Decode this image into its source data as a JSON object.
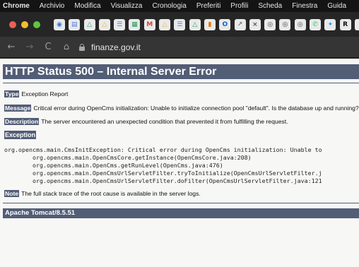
{
  "menubar": {
    "app": "Chrome",
    "items": [
      "Archivio",
      "Modifica",
      "Visualizza",
      "Cronologia",
      "Preferiti",
      "Profili",
      "Scheda",
      "Finestra",
      "Guida"
    ]
  },
  "tabs": {
    "icons": [
      {
        "name": "globe-icon",
        "glyph": "◉",
        "color": "#3a6fd8"
      },
      {
        "name": "docs-icon",
        "glyph": "▤",
        "color": "#4a7ee8"
      },
      {
        "name": "drive-icon",
        "glyph": "△",
        "color": "#2ea160"
      },
      {
        "name": "drive-icon",
        "glyph": "△",
        "color": "#f2b233"
      },
      {
        "name": "docs-icon",
        "glyph": "☰",
        "color": "#4a7ee8"
      },
      {
        "name": "sheets-icon",
        "glyph": "▦",
        "color": "#1f9b57"
      },
      {
        "name": "gmail-icon",
        "glyph": "M",
        "color": "#d44638"
      },
      {
        "name": "drive-icon",
        "glyph": "△",
        "color": "#f2b233"
      },
      {
        "name": "docs-icon",
        "glyph": "☰",
        "color": "#4a7ee8"
      },
      {
        "name": "drive-icon",
        "glyph": "△",
        "color": "#2ea160"
      },
      {
        "name": "analytics-icon",
        "glyph": "▮",
        "color": "#e37400"
      },
      {
        "name": "outlook-icon",
        "glyph": "O",
        "color": "#0a64c8"
      },
      {
        "name": "sparkline-icon",
        "glyph": "↗",
        "color": "#777777"
      },
      {
        "name": "tab-close-icon",
        "glyph": "×",
        "color": "#555555"
      },
      {
        "name": "circle-icon",
        "glyph": "◎",
        "color": "#444444"
      },
      {
        "name": "circle-icon",
        "glyph": "◎",
        "color": "#444444"
      },
      {
        "name": "circle-icon",
        "glyph": "◎",
        "color": "#444444"
      },
      {
        "name": "whatsapp-icon",
        "glyph": "✆",
        "color": "#25d366"
      },
      {
        "name": "twitter-icon",
        "glyph": "✦",
        "color": "#1da1f2"
      },
      {
        "name": "r-icon",
        "glyph": "R",
        "color": "#111111"
      },
      {
        "name": "doc-icon",
        "glyph": "▯",
        "color": "#6b6b6b"
      }
    ]
  },
  "address_bar": {
    "url": "finanze.gov.it"
  },
  "page": {
    "title": "HTTP Status 500 – Internal Server Error",
    "type_label": "Type",
    "type_value": "Exception Report",
    "message_label": "Message",
    "message_value": "Critical error during OpenCms initialization: Unable to initialize connection pool \"default\". Is the database up and running?",
    "description_label": "Description",
    "description_value": "The server encountered an unexpected condition that prevented it from fulfilling the request.",
    "exception_label": "Exception",
    "stack": [
      "org.opencms.main.CmsInitException: Critical error during OpenCms initialization: Unable to",
      "        org.opencms.main.OpenCmsCore.getInstance(OpenCmsCore.java:208)",
      "        org.opencms.main.OpenCms.getRunLevel(OpenCms.java:476)",
      "        org.opencms.main.OpenCmsUrlServletFilter.tryToInitialize(OpenCmsUrlServletFilter.j",
      "        org.opencms.main.OpenCmsUrlServletFilter.doFilter(OpenCmsUrlServletFilter.java:121"
    ],
    "note_label": "Note",
    "note_value": "The full stack trace of the root cause is available in the server logs.",
    "footer": "Apache Tomcat/8.5.51"
  },
  "colors": {
    "header_bar": "#525d76"
  }
}
